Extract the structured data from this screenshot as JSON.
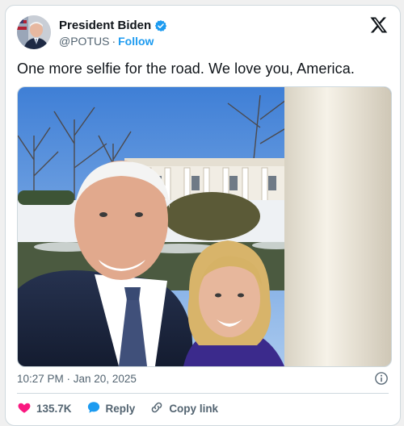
{
  "author": {
    "display_name": "President Biden",
    "handle": "@POTUS",
    "separator": "·",
    "follow_label": "Follow",
    "verified": true
  },
  "post": {
    "text": "One more selfie for the road. We love you, America.",
    "timestamp": "10:27 PM · Jan 20, 2025",
    "image": {
      "scene": "outdoor selfie, snowy lawn, white colonnade, winter trees, blue sky"
    }
  },
  "actions": {
    "likes_count": "135.7K",
    "reply_label": "Reply",
    "copy_link_label": "Copy link"
  },
  "colors": {
    "accent": "#1d9bf0",
    "like_red": "#f91880",
    "secondary_text": "#536471",
    "border": "#cfd9de"
  },
  "icons": [
    "verified-badge-icon",
    "x-logo-icon",
    "info-icon",
    "heart-icon",
    "reply-icon",
    "link-icon"
  ]
}
